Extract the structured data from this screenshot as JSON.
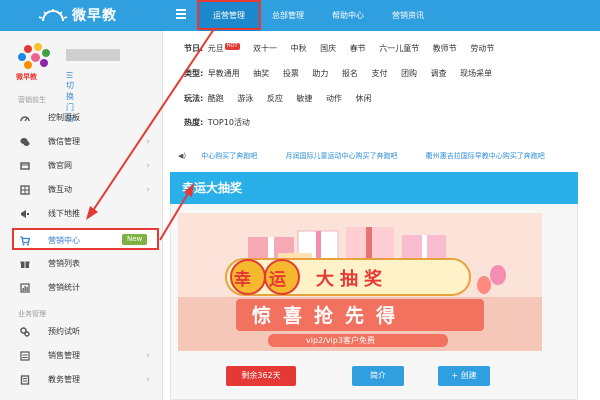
{
  "app": {
    "logo_text": "微早教"
  },
  "topnav": {
    "tabs": [
      {
        "label": "运营管理",
        "active": true
      },
      {
        "label": "总部管理",
        "active": false
      },
      {
        "label": "帮助中心",
        "active": false
      },
      {
        "label": "营销资讯",
        "active": false
      }
    ]
  },
  "sidebar": {
    "avatar_name": "微早教",
    "switch_store": "切换门店",
    "section1": "营销前生",
    "items": [
      {
        "label": "控制面板",
        "icon": "dashboard-icon"
      },
      {
        "label": "微信管理",
        "icon": "wechat-icon"
      },
      {
        "label": "微官网",
        "icon": "website-icon"
      },
      {
        "label": "微互动",
        "icon": "grid-icon"
      },
      {
        "label": "线下地推",
        "icon": "megaphone-icon"
      },
      {
        "label": "营销中心",
        "icon": "cart-icon",
        "badge": "New"
      },
      {
        "label": "营销列表",
        "icon": "gift-icon"
      },
      {
        "label": "营销统计",
        "icon": "chart-icon"
      }
    ],
    "section2": "业务管理",
    "items2": [
      {
        "label": "预约试听",
        "icon": "gears-icon"
      },
      {
        "label": "销售管理",
        "icon": "sales-icon"
      },
      {
        "label": "教务管理",
        "icon": "book-icon"
      }
    ]
  },
  "filters": {
    "festival": {
      "label": "节日:",
      "options": [
        "元旦",
        "双十一",
        "中秋",
        "国庆",
        "春节",
        "六一儿童节",
        "教师节",
        "劳动节"
      ],
      "hot": "HOT"
    },
    "type": {
      "label": "类型:",
      "options": [
        "早教通用",
        "抽奖",
        "投票",
        "助力",
        "报名",
        "支付",
        "团购",
        "调查",
        "现场采单"
      ]
    },
    "gameplay": {
      "label": "玩法:",
      "options": [
        "酷跑",
        "游泳",
        "反应",
        "敏捷",
        "动作",
        "休闲"
      ]
    },
    "heat": {
      "label": "热度:",
      "options": [
        "TOP10活动"
      ]
    }
  },
  "ticker": {
    "messages": [
      "中心购买了奔跑吧",
      "月润国际儿童运动中心购买了奔跑吧",
      "衢州惠吉拉国际早教中心购买了奔跑吧"
    ]
  },
  "card": {
    "title": "幸运大抽奖",
    "banner_title_1": "幸运",
    "banner_title_2": "大抽奖",
    "banner_subtitle": "惊喜抢先得",
    "banner_note": "vip2/vip3客户免费",
    "remaining": "剩余362天",
    "intro_button": "简介",
    "create_button": "+ 创建"
  },
  "colors": {
    "primary": "#2f9fe0",
    "card_header": "#29b0e8",
    "danger": "#e53935",
    "new_badge": "#7cb342"
  }
}
